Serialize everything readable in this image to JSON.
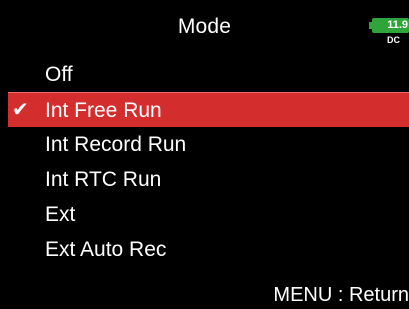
{
  "header": {
    "title": "Mode"
  },
  "battery": {
    "voltage": "11.9",
    "source": "DC",
    "color": "#2ea43a",
    "icon": "battery-icon"
  },
  "menu": {
    "selected_index": 1,
    "selected_color": "#d42d2d",
    "check_icon": "checkmark-icon",
    "items": [
      {
        "label": "Off"
      },
      {
        "label": "Int Free Run"
      },
      {
        "label": "Int Record Run"
      },
      {
        "label": "Int RTC Run"
      },
      {
        "label": "Ext"
      },
      {
        "label": "Ext Auto Rec"
      }
    ]
  },
  "footer": {
    "hint": "MENU : Return"
  }
}
